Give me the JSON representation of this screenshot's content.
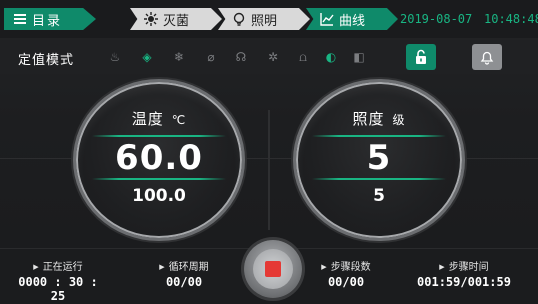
{
  "topbar": {
    "menu_label": "目录",
    "tabs": [
      {
        "label": "灭菌",
        "icon": "sterilize-icon"
      },
      {
        "label": "照明",
        "icon": "bulb-icon"
      },
      {
        "label": "曲线",
        "icon": "chart-line-icon"
      }
    ],
    "date": "2019-08-07",
    "time": "10:48:48"
  },
  "modebar": {
    "label": "定值模式",
    "icons": [
      "heater-icon",
      "humidify-icon",
      "cool-icon",
      "dehumidify-icon",
      "fan-icon",
      "defrost-icon",
      "heat-element-icon",
      "water-drop-icon",
      "door-icon"
    ],
    "lock_icon": "unlock-icon",
    "bell_icon": "bell-icon"
  },
  "temperature": {
    "title": "温度",
    "unit": "℃",
    "value": "60.0",
    "setpoint": "100.0"
  },
  "illumination": {
    "title": "照度",
    "unit": "级",
    "value": "5",
    "setpoint": "5"
  },
  "bottombar": {
    "running_label": "正在运行",
    "running_value": "0000 : 30 : 25",
    "cycle_label": "循环周期",
    "cycle_value": "00/00",
    "step_label": "步骤段数",
    "step_value": "00/00",
    "steptime_label": "步骤时间",
    "steptime_value": "001:59/001:59",
    "stop_icon": "stop-icon"
  },
  "colors": {
    "accent": "#0f8a6a",
    "accent_text": "#19b583",
    "stop": "#e53935"
  }
}
